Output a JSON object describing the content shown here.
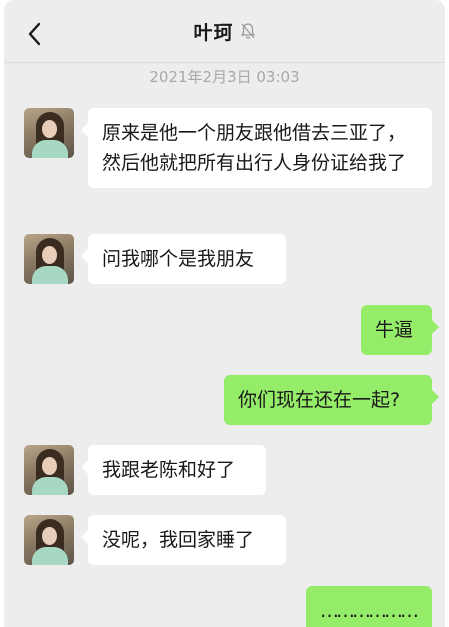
{
  "header": {
    "title": "叶珂",
    "back_icon": "chevron-left-icon",
    "mute_icon": "bell-off-icon"
  },
  "timestamp": "2021年2月3日 03:03",
  "colors": {
    "background": "#ededed",
    "incoming_bubble": "#ffffff",
    "outgoing_bubble": "#95ec69"
  },
  "messages": [
    {
      "side": "in",
      "text": "原来是他一个朋友跟他借去三亚了，然后他就把所有出行人身份证给我了"
    },
    {
      "side": "in",
      "text": "问我哪个是我朋友"
    },
    {
      "side": "out",
      "text": "牛逼"
    },
    {
      "side": "out",
      "text": "你们现在还在一起?"
    },
    {
      "side": "in",
      "text": "我跟老陈和好了"
    },
    {
      "side": "in",
      "text": "没呢，我回家睡了"
    },
    {
      "side": "out",
      "text": "………………"
    }
  ]
}
